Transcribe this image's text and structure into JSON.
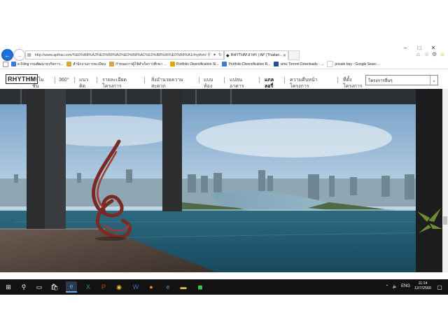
{
  "browser": {
    "window_controls": [
      "–",
      "□",
      "✕"
    ],
    "url": "http://www.apthai.com/%E0%B8%A3%E0%B8%AD%E0%B8%A1%E0%B8%96%E0%B8%A1/rhythm/t",
    "active_tab_label": "RHYTHM สาทร | AP (Thailan...",
    "favorites": [
      {
        "label": "e-Filing กรมพัฒนาธุรกิจการ...",
        "color": "#3a7bd5"
      },
      {
        "label": "สำนักงานการทะเบียน",
        "color": "#d9a441"
      },
      {
        "label": "กำหนดการผู้ใช้สำเร็จการศึกษา ...",
        "color": "#d9a441"
      },
      {
        "label": "Portfolio Diversification Sl...",
        "color": "#e0a800"
      },
      {
        "label": "Portfolio Diversification R...",
        "color": "#3a7bd5"
      },
      {
        "label": "sims Torrent Downloads - ...",
        "color": "#1e4e9c"
      },
      {
        "label": "private bay - Google Searc...",
        "color": "#e7e7e7"
      }
    ]
  },
  "site": {
    "logo": "RHYTHM",
    "nav": [
      {
        "l1": "ปริโม",
        "l2": "ชั่น",
        "active": false
      },
      {
        "l1": "360°",
        "l2": "",
        "active": false
      },
      {
        "l1": "แนว",
        "l2": "คิด",
        "active": false
      },
      {
        "l1": "รายละเอียด",
        "l2": "โครงการ",
        "active": false
      },
      {
        "l1": "สิ่งอำนวยความ",
        "l2": "สะดวก",
        "active": false
      },
      {
        "l1": "แบบ",
        "l2": "ห้อง",
        "active": false
      },
      {
        "l1": "แปลน",
        "l2": "อาคาร",
        "active": false
      },
      {
        "l1": "แกล",
        "l2": "ลอรี่",
        "active": true
      },
      {
        "l1": "ความคืบหน้า",
        "l2": "โครงการ",
        "active": false
      },
      {
        "l1": "ที่ตั้ง",
        "l2": "โครงการ",
        "active": false
      }
    ],
    "project_select_value": "โครงการอื่นๆ"
  },
  "taskbar": {
    "apps": [
      "start",
      "search",
      "task-view",
      "store",
      "ie",
      "excel",
      "powerpoint",
      "chrome",
      "word",
      "firefox",
      "edge",
      "explorer",
      "line"
    ],
    "language": "ENG",
    "time": "11:14",
    "date": "12/7/2560"
  }
}
